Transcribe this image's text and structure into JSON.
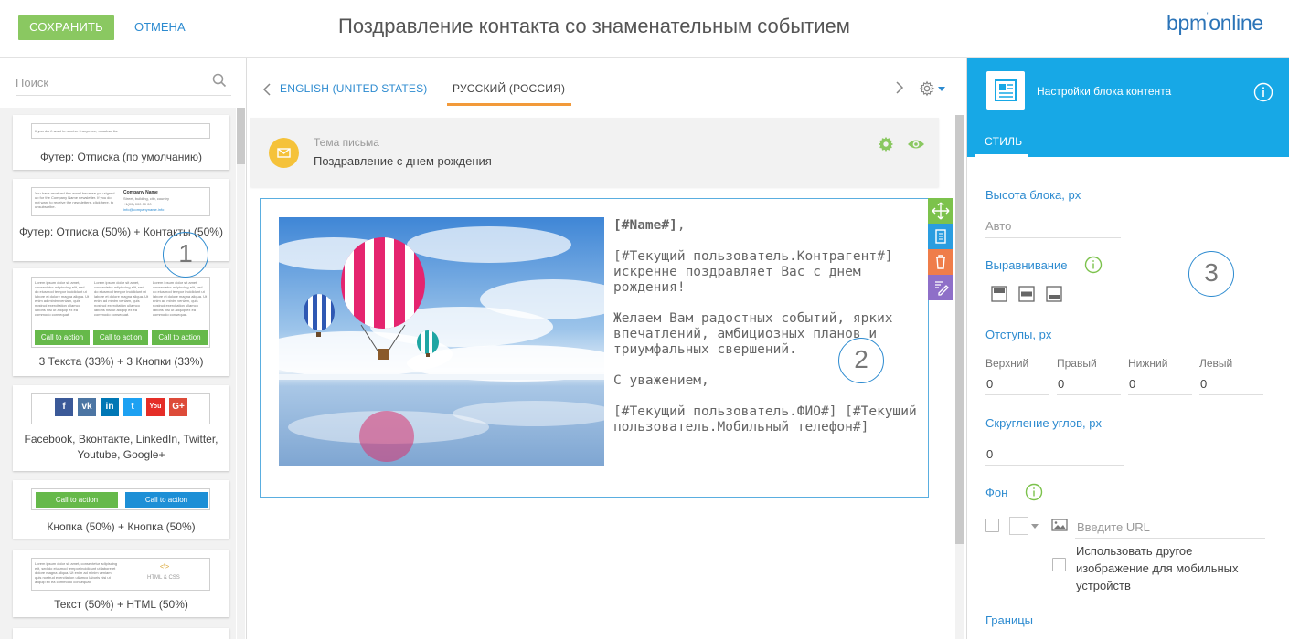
{
  "header": {
    "save_label": "СОХРАНИТЬ",
    "cancel_label": "ОТМЕНА",
    "title": "Поздравление контакта со знаменательным событием",
    "logo_text": "bpm",
    "logo_sup": "'",
    "logo_text2": "online"
  },
  "sidebar": {
    "search_placeholder": "Поиск",
    "cards": [
      {
        "label": "Футер: Отписка (по умолчанию)",
        "preview_text": "If you don't want to receive it anymore, unsubscribe"
      },
      {
        "label": "Футер: Отписка (50%) + Контакты (50%)",
        "preview_left": "You have received this email because you signed up for the Company Name newsletter. If you do not want to receive the newsletters, click here, to unsubscribe.",
        "preview_company": "Company Name",
        "preview_address": "Street, building, city, country",
        "preview_phone": "+1(00) 000 00 00",
        "preview_email": "info@companyname.info"
      },
      {
        "label": "3 Текста (33%) + 3 Кнопки (33%)",
        "preview_text": "Lorem ipsum dolor sit amet, consectetur adipiscing elit, sed do eiusmod tempor incididunt ut labore et dolore magna aliqua. Ut enim ad minim veniam, quis nostrud exercitation ullamco laboris nisi ut aliquip ex ea commodo consequat.",
        "cta": "Call to action"
      },
      {
        "label": "Facebook, Вконтакте, LinkedIn, Twitter, Youtube, Google+"
      },
      {
        "label": "Кнопка (50%) + Кнопка (50%)",
        "cta": "Call to action"
      },
      {
        "label": "Текст (50%) + HTML (50%)",
        "preview_text": "Lorem ipsum dolor sit amet, consectetur adipiscing elit, sed do eiusmod tempor incididunt ut labore et dolore magna aliqua. Ut enim ad minim veniam, quis nostrud exercitation ullamco laboris nisi ut aliquip ex ea commodo consequat.",
        "html_tag": "<\\>",
        "html_label": "HTML & CSS"
      }
    ],
    "social_icons": [
      {
        "glyph": "f",
        "color": "#3b5998"
      },
      {
        "glyph": "vk",
        "color": "#4c75a3"
      },
      {
        "glyph": "in",
        "color": "#0077b5"
      },
      {
        "glyph": "t",
        "color": "#1da1f2"
      },
      {
        "glyph": "You",
        "color": "#e52d27"
      },
      {
        "glyph": "G+",
        "color": "#dd4b39"
      }
    ],
    "marker_1": "1"
  },
  "editor": {
    "tabs": [
      {
        "label": "ENGLISH (UNITED STATES)",
        "active": false
      },
      {
        "label": "РУССКИЙ (РОССИЯ)",
        "active": true
      }
    ],
    "subject_label": "Тема письма",
    "subject_value": "Поздравление с днем рождения",
    "letter": {
      "greeting": "[#Name#]",
      "greeting_suffix": ",",
      "p1": "[#Текущий пользователь.Контрагент#] искренне поздравляет Вас с днем рождения!",
      "p2": "Желаем Вам радостных событий, ярких впечатлений, амбициозных планов и триумфальных свершений.",
      "p3": "С уважением,",
      "p4": "[#Текущий пользователь.ФИО#] [#Текущий пользователь.Мобильный телефон#]"
    },
    "marker_2": "2"
  },
  "settings": {
    "title": "Настройки блока контента",
    "tab": "СТИЛЬ",
    "height_label": "Высота блока, px",
    "height_value": "Авто",
    "align_label": "Выравнивание",
    "padding_label": "Отступы, px",
    "padding": [
      {
        "label": "Верхний",
        "value": "0"
      },
      {
        "label": "Правый",
        "value": "0"
      },
      {
        "label": "Нижний",
        "value": "0"
      },
      {
        "label": "Левый",
        "value": "0"
      }
    ],
    "radius_label": "Скругление углов, px",
    "radius_value": "0",
    "bg_label": "Фон",
    "url_placeholder": "Введите URL",
    "mobile_image_label": "Использовать другое изображение для мобильных устройств",
    "borders_label": "Границы",
    "marker_3": "3"
  },
  "colors": {
    "accent_blue": "#17a8e6",
    "link_blue": "#2d8bd0",
    "save_green": "#8ac861",
    "tab_orange": "#f29a3a"
  }
}
